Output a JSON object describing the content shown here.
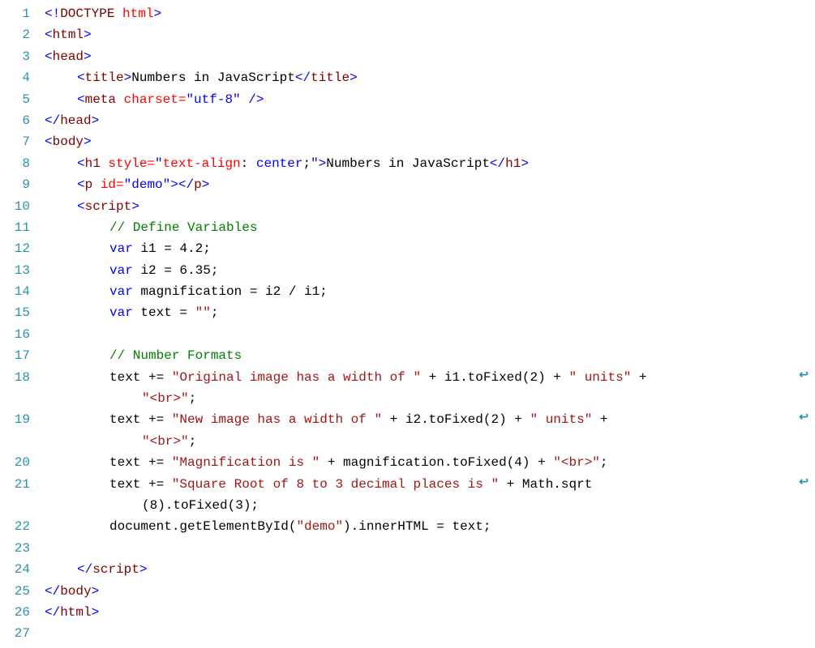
{
  "editor": {
    "lines": [
      {
        "num": "1",
        "cls": "",
        "tokens": [
          [
            "blue",
            "<!"
          ],
          [
            "darkred",
            "DOCTYPE"
          ],
          [
            "black",
            " "
          ],
          [
            "red",
            "html"
          ],
          [
            "blue",
            ">"
          ]
        ]
      },
      {
        "num": "2",
        "cls": "",
        "tokens": [
          [
            "blue",
            "<"
          ],
          [
            "darkred",
            "html"
          ],
          [
            "blue",
            ">"
          ]
        ]
      },
      {
        "num": "3",
        "cls": "",
        "tokens": [
          [
            "blue",
            "<"
          ],
          [
            "darkred",
            "head"
          ],
          [
            "blue",
            ">"
          ]
        ]
      },
      {
        "num": "4",
        "cls": "indent1",
        "tokens": [
          [
            "blue",
            "<"
          ],
          [
            "darkred",
            "title"
          ],
          [
            "blue",
            ">"
          ],
          [
            "black",
            "Numbers in JavaScript"
          ],
          [
            "blue",
            "</"
          ],
          [
            "darkred",
            "title"
          ],
          [
            "blue",
            ">"
          ]
        ]
      },
      {
        "num": "5",
        "cls": "indent1",
        "tokens": [
          [
            "blue",
            "<"
          ],
          [
            "darkred",
            "meta"
          ],
          [
            "black",
            " "
          ],
          [
            "red",
            "charset="
          ],
          [
            "blue",
            "\"utf-8\""
          ],
          [
            "black",
            " "
          ],
          [
            "blue",
            "/>"
          ]
        ]
      },
      {
        "num": "6",
        "cls": "",
        "tokens": [
          [
            "blue",
            "</"
          ],
          [
            "darkred",
            "head"
          ],
          [
            "blue",
            ">"
          ]
        ]
      },
      {
        "num": "7",
        "cls": "",
        "tokens": [
          [
            "blue",
            "<"
          ],
          [
            "darkred",
            "body"
          ],
          [
            "blue",
            ">"
          ]
        ]
      },
      {
        "num": "8",
        "cls": "indent1",
        "tokens": [
          [
            "blue",
            "<"
          ],
          [
            "darkred",
            "h1"
          ],
          [
            "black",
            " "
          ],
          [
            "red",
            "style="
          ],
          [
            "blue",
            "\""
          ],
          [
            "red",
            "text-align"
          ],
          [
            "black",
            ": "
          ],
          [
            "blue",
            "center"
          ],
          [
            "black",
            ";"
          ],
          [
            "blue",
            "\">"
          ],
          [
            "black",
            "Numbers in JavaScript"
          ],
          [
            "blue",
            "</"
          ],
          [
            "darkred",
            "h1"
          ],
          [
            "blue",
            ">"
          ]
        ]
      },
      {
        "num": "9",
        "cls": "indent1",
        "tokens": [
          [
            "blue",
            "<"
          ],
          [
            "darkred",
            "p"
          ],
          [
            "black",
            " "
          ],
          [
            "red",
            "id="
          ],
          [
            "blue",
            "\"demo\">"
          ],
          [
            "blue",
            "</"
          ],
          [
            "darkred",
            "p"
          ],
          [
            "blue",
            ">"
          ]
        ]
      },
      {
        "num": "10",
        "cls": "indent1",
        "tokens": [
          [
            "blue",
            "<"
          ],
          [
            "darkred",
            "script"
          ],
          [
            "blue",
            ">"
          ]
        ]
      },
      {
        "num": "11",
        "cls": "indent2",
        "tokens": [
          [
            "green",
            "// Define Variables"
          ]
        ]
      },
      {
        "num": "12",
        "cls": "indent2",
        "tokens": [
          [
            "blue",
            "var"
          ],
          [
            "black",
            " i1 = 4.2;"
          ]
        ]
      },
      {
        "num": "13",
        "cls": "indent2",
        "tokens": [
          [
            "blue",
            "var"
          ],
          [
            "black",
            " i2 = 6.35;"
          ]
        ]
      },
      {
        "num": "14",
        "cls": "indent2",
        "tokens": [
          [
            "blue",
            "var"
          ],
          [
            "black",
            " magnification = i2 / i1;"
          ]
        ]
      },
      {
        "num": "15",
        "cls": "indent2",
        "tokens": [
          [
            "blue",
            "var"
          ],
          [
            "black",
            " text = "
          ],
          [
            "str",
            "\"\""
          ],
          [
            "black",
            ";"
          ]
        ]
      },
      {
        "num": "16",
        "cls": "",
        "tokens": [
          [
            "black",
            ""
          ]
        ]
      },
      {
        "num": "17",
        "cls": "indent2",
        "tokens": [
          [
            "green",
            "// Number Formats"
          ]
        ]
      },
      {
        "num": "18",
        "cls": "indent2",
        "wrap": true,
        "tokens": [
          [
            "black",
            "text += "
          ],
          [
            "str",
            "\"Original image has a width of \""
          ],
          [
            "black",
            " + i1.toFixed(2) + "
          ],
          [
            "str",
            "\" units\""
          ],
          [
            "black",
            " + "
          ]
        ]
      },
      {
        "num": "",
        "cls": "indent3",
        "tokens": [
          [
            "str",
            "\"<br>\""
          ],
          [
            "black",
            ";"
          ]
        ]
      },
      {
        "num": "19",
        "cls": "indent2",
        "wrap": true,
        "tokens": [
          [
            "black",
            "text += "
          ],
          [
            "str",
            "\"New image has a width of \""
          ],
          [
            "black",
            " + i2.toFixed(2) + "
          ],
          [
            "str",
            "\" units\""
          ],
          [
            "black",
            " + "
          ]
        ]
      },
      {
        "num": "",
        "cls": "indent3",
        "tokens": [
          [
            "str",
            "\"<br>\""
          ],
          [
            "black",
            ";"
          ]
        ]
      },
      {
        "num": "20",
        "cls": "indent2",
        "tokens": [
          [
            "black",
            "text += "
          ],
          [
            "str",
            "\"Magnification is \""
          ],
          [
            "black",
            " + magnification.toFixed(4) + "
          ],
          [
            "str",
            "\"<br>\""
          ],
          [
            "black",
            ";"
          ]
        ]
      },
      {
        "num": "21",
        "cls": "indent2",
        "wrap": true,
        "tokens": [
          [
            "black",
            "text += "
          ],
          [
            "str",
            "\"Square Root of 8 to 3 decimal places is \""
          ],
          [
            "black",
            " + Math.sqrt"
          ]
        ]
      },
      {
        "num": "",
        "cls": "indent3",
        "tokens": [
          [
            "black",
            "(8).toFixed(3);"
          ]
        ]
      },
      {
        "num": "22",
        "cls": "indent2",
        "tokens": [
          [
            "black",
            "document.getElementById("
          ],
          [
            "str",
            "\"demo\""
          ],
          [
            "black",
            ").innerHTML = text;"
          ]
        ]
      },
      {
        "num": "23",
        "cls": "",
        "tokens": [
          [
            "black",
            ""
          ]
        ]
      },
      {
        "num": "24",
        "cls": "indent1",
        "tokens": [
          [
            "blue",
            "</"
          ],
          [
            "darkred",
            "script"
          ],
          [
            "blue",
            ">"
          ]
        ]
      },
      {
        "num": "25",
        "cls": "",
        "tokens": [
          [
            "blue",
            "</"
          ],
          [
            "darkred",
            "body"
          ],
          [
            "blue",
            ">"
          ]
        ]
      },
      {
        "num": "26",
        "cls": "",
        "tokens": [
          [
            "blue",
            "</"
          ],
          [
            "darkred",
            "html"
          ],
          [
            "blue",
            ">"
          ]
        ]
      },
      {
        "num": "27",
        "cls": "",
        "tokens": [
          [
            "black",
            ""
          ]
        ]
      }
    ],
    "wrap_glyph": "↩"
  }
}
